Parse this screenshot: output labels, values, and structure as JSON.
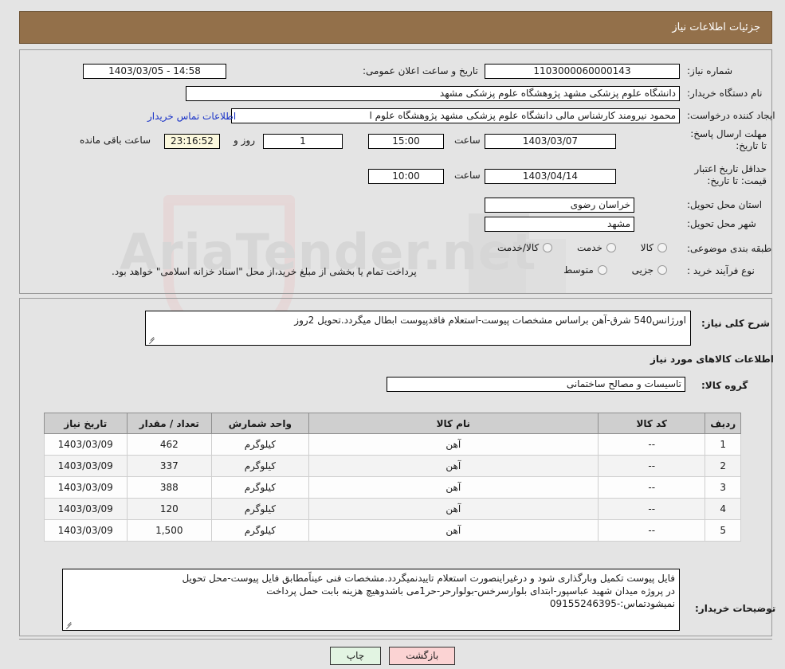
{
  "header": {
    "title": "جزئیات اطلاعات نیاز"
  },
  "watermark": {
    "text": "AriaTender.net"
  },
  "top_form": {
    "need_number": {
      "label": "شماره نیاز:",
      "value": "1103000060000143"
    },
    "announce_datetime": {
      "label": "تاریخ و ساعت اعلان عمومی:",
      "value": "1403/03/05 - 14:58"
    },
    "buyer_org": {
      "label": "نام دستگاه خریدار:",
      "value": "دانشگاه علوم پزشکی مشهد   پژوهشگاه علوم پزشکی مشهد"
    },
    "requester": {
      "label": "ایجاد کننده درخواست:",
      "value": "محمود نیرومند کارشناس مالی دانشگاه علوم پزشکی مشهد   پژوهشگاه علوم ا",
      "contact_link": "اطلاعات تماس خریدار"
    },
    "response_deadline": {
      "label": "مهلت ارسال پاسخ: تا تاریخ:",
      "date": "1403/03/07",
      "hour_label": "ساعت",
      "time": "15:00",
      "days": "1",
      "days_label": "روز و",
      "countdown": "23:16:52",
      "countdown_label": "ساعت باقی مانده"
    },
    "price_validity": {
      "label": "حداقل تاریخ اعتبار قیمت: تا تاریخ:",
      "date": "1403/04/14",
      "hour_label": "ساعت",
      "time": "10:00"
    },
    "delivery_province": {
      "label": "استان محل تحویل:",
      "value": "خراسان رضوی"
    },
    "delivery_city": {
      "label": "شهر محل تحویل:",
      "value": "مشهد"
    },
    "subject_classification": {
      "label": "طبقه بندی موضوعی:",
      "options": [
        "کالا",
        "خدمت",
        "کالا/خدمت"
      ],
      "selected": ""
    },
    "purchase_process": {
      "label": "نوع فرآیند خرید :",
      "options": [
        "جزیی",
        "متوسط"
      ],
      "selected": "",
      "note": "پرداخت تمام یا بخشی از مبلغ خرید،از محل \"اسناد خزانه اسلامی\" خواهد بود."
    }
  },
  "need_description": {
    "label": "شرح کلی نیاز:",
    "value": "اورژانس540 شرق-آهن براساس مشخصات پیوست-استعلام فاقدپیوست ابطال میگردد.تحویل 2روز"
  },
  "goods_section": {
    "heading": "اطلاعات کالاهای مورد نیاز",
    "group_label": "گروه کالا:",
    "group_value": "تاسیسات و مصالح ساختمانی"
  },
  "goods_table": {
    "columns": [
      "ردیف",
      "کد کالا",
      "نام کالا",
      "واحد شمارش",
      "تعداد / مقدار",
      "تاریخ نیاز"
    ],
    "rows": [
      {
        "row": "1",
        "code": "--",
        "name": "آهن",
        "unit": "کیلوگرم",
        "qty": "462",
        "date": "1403/03/09"
      },
      {
        "row": "2",
        "code": "--",
        "name": "آهن",
        "unit": "کیلوگرم",
        "qty": "337",
        "date": "1403/03/09"
      },
      {
        "row": "3",
        "code": "--",
        "name": "آهن",
        "unit": "کیلوگرم",
        "qty": "388",
        "date": "1403/03/09"
      },
      {
        "row": "4",
        "code": "--",
        "name": "آهن",
        "unit": "کیلوگرم",
        "qty": "120",
        "date": "1403/03/09"
      },
      {
        "row": "5",
        "code": "--",
        "name": "آهن",
        "unit": "کیلوگرم",
        "qty": "1,500",
        "date": "1403/03/09"
      }
    ]
  },
  "buyer_notes": {
    "label": "توضیحات خریدار:",
    "lines": [
      "فایل پیوست تکمیل وبارگذاری شود و درغیراینصورت استعلام تاییدنمیگردد.مشخصات فنی عیناًمطابق فایل پیوست-محل تحویل",
      "در پروژه میدان شهید عباسپور-ابتدای بلوارسرخس-بولوارحر-حر1می باشدوهیچ هزینه بابت حمل  پرداخت",
      "نمیشودتماس:-09155246395"
    ]
  },
  "footer": {
    "print_label": "چاپ",
    "back_label": "بازگشت"
  },
  "colors": {
    "header_bg": "#93704a",
    "link": "#1b34c8",
    "table_header_bg": "#cfcfcf",
    "print_btn_bg": "#e2f4e2",
    "back_btn_bg": "#fbd3d3",
    "countdown_bg": "#fbf8dd"
  }
}
